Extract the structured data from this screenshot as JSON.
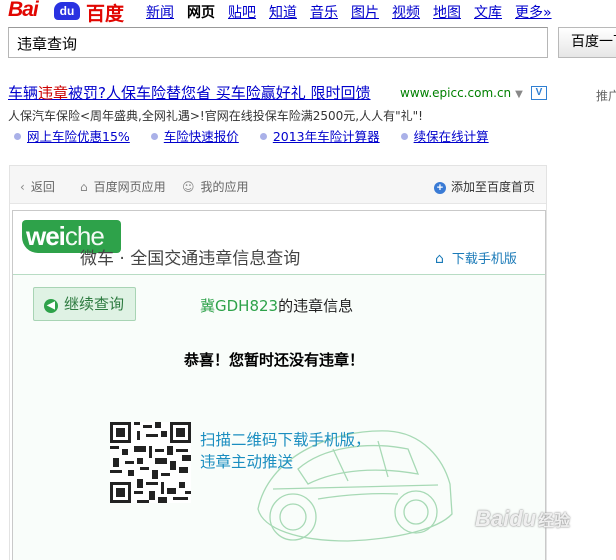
{
  "header": {
    "logo": {
      "bai": "Bai",
      "du": "du",
      "cn": "百度"
    },
    "nav": [
      "新闻",
      "网页",
      "贴吧",
      "知道",
      "音乐",
      "图片",
      "视频",
      "地图",
      "文库",
      "更多»"
    ],
    "active_nav": "网页"
  },
  "search": {
    "value": "违章查询",
    "button_label": "百度一下"
  },
  "ad": {
    "title_a": "车辆",
    "title_kw": "违章",
    "title_b": "被罚?人保车险替您省 买车险赢好礼 限时回馈",
    "url": "www.epicc.com.cn",
    "verified": "V",
    "promo": "推广",
    "desc": "人保汽车保险<周年盛典,全网礼遇>!官网在线投保车险满2500元,人人有\"礼\"!",
    "links": [
      "网上车险优惠15%",
      "车险快速报价",
      "2013年车险计算器",
      "续保在线计算"
    ]
  },
  "app_toolbar": {
    "back": "返回",
    "apps": "百度网页应用",
    "mine": "我的应用",
    "add": "添加至百度首页"
  },
  "app": {
    "logo": {
      "wei": "wei",
      "che": "che"
    },
    "title": "微车 · 全国交通违章信息查询",
    "download_label": "下载手机版",
    "continue_label": "继续查询",
    "plate": "冀GDH823",
    "plate_suffix": "的违章信息",
    "congrats": "恭喜！您暂时还没有违章！",
    "scan_line1": "扫描二维码下载手机版，",
    "scan_line2": "违章主动推送"
  },
  "watermark": {
    "brand": "Baidu",
    "suffix": "经验"
  },
  "colors": {
    "brand_red": "#e10601",
    "brand_blue": "#2932e1",
    "link": "#0000cc",
    "weiche_green": "#2ea24a",
    "scan_blue": "#1b8ec0"
  },
  "icons": [
    "back-arrow-icon",
    "home-icon",
    "user-icon",
    "add-circle-icon",
    "house-icon",
    "left-arrow-icon",
    "qr-code-icon",
    "car-illustration",
    "dropdown-icon",
    "verified-v-icon"
  ]
}
